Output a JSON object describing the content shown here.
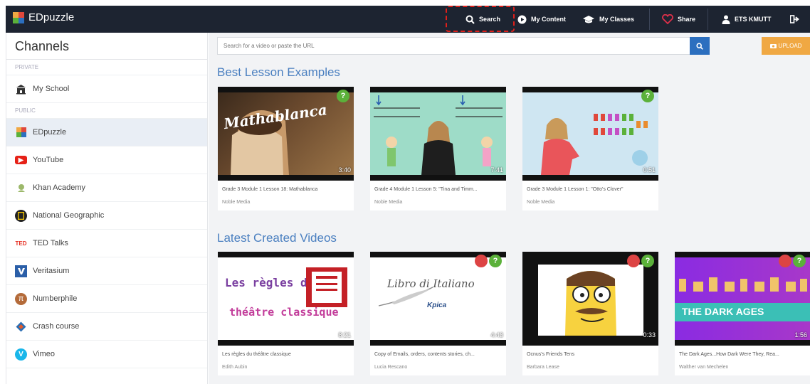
{
  "app": {
    "name": "EDpuzzle"
  },
  "nav": {
    "search": "Search",
    "my_content": "My Content",
    "my_classes": "My Classes",
    "share": "Share",
    "user": "ETS KMUTT"
  },
  "sidebar": {
    "title": "Channels",
    "private_label": "PRIVATE",
    "public_label": "PUBLIC",
    "private_items": [
      {
        "label": "My School",
        "icon": "school-icon"
      }
    ],
    "public_items": [
      {
        "label": "EDpuzzle",
        "icon": "edpuzzle-icon"
      },
      {
        "label": "YouTube",
        "icon": "youtube-icon"
      },
      {
        "label": "Khan Academy",
        "icon": "khan-academy-icon"
      },
      {
        "label": "National Geographic",
        "icon": "national-geographic-icon"
      },
      {
        "label": "TED Talks",
        "icon": "ted-icon"
      },
      {
        "label": "Veritasium",
        "icon": "veritasium-icon"
      },
      {
        "label": "Numberphile",
        "icon": "numberphile-icon"
      },
      {
        "label": "Crash course",
        "icon": "crash-course-icon"
      },
      {
        "label": "Vimeo",
        "icon": "vimeo-icon"
      }
    ]
  },
  "search": {
    "placeholder": "Search for a video or paste the URL",
    "upload_label": "UPLOAD"
  },
  "best": {
    "title": "Best Lesson Examples",
    "videos": [
      {
        "title": "Grade 3 Module 1 Lesson 18: Mathablanca",
        "author": "Noble Media",
        "duration": "3:40",
        "thumb_text": "Mathablanca"
      },
      {
        "title": "Grade 4 Module 1 Lesson 5: \"Tina and Timm...",
        "author": "Noble Media",
        "duration": "7:41"
      },
      {
        "title": "Grade 3 Module 1 Lesson 1: \"Otto's Clover\"",
        "author": "Noble Media",
        "duration": "0:51"
      }
    ]
  },
  "latest": {
    "title": "Latest Created Videos",
    "videos": [
      {
        "title": "Les règles du théâtre classique",
        "author": "Edith Aubin",
        "duration": "8:21",
        "thumb_line1": "Les règles du",
        "thumb_line2": "théâtre classique"
      },
      {
        "title": "Copy of Emails, orders, contents stories, ch...",
        "author": "Lucia Rescano",
        "duration": "4:43",
        "thumb_line1": "Libro di Italiano",
        "thumb_line2": "Kpica"
      },
      {
        "title": "Ocnus's Friends Tens",
        "author": "Barbara Lease",
        "duration": "0:33"
      },
      {
        "title": "The Dark Ages...How Dark Were They, Rea...",
        "author": "Walther van Mechelen",
        "duration": "1:56",
        "thumb_line1": "THE DARK AGES"
      }
    ]
  }
}
